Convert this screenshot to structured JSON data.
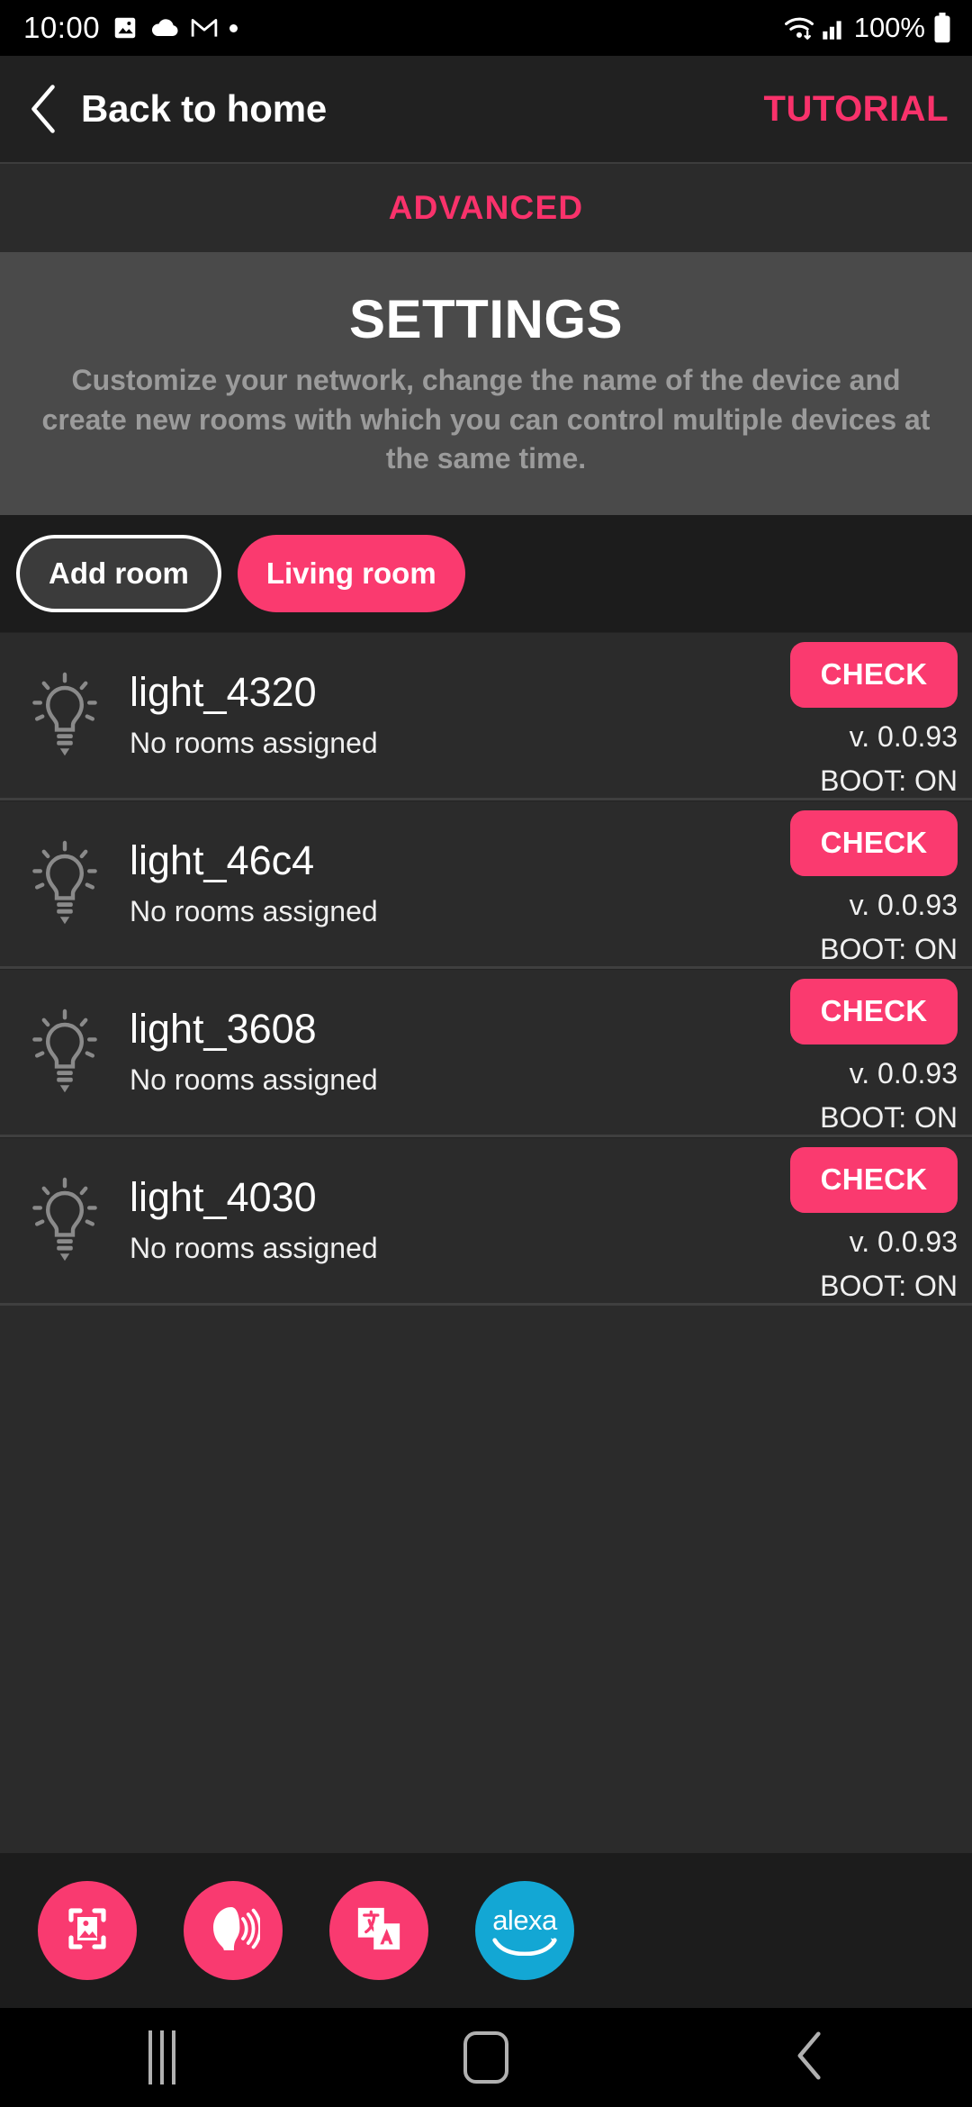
{
  "status_bar": {
    "time": "10:00",
    "icons": [
      "image-icon",
      "cloud-icon",
      "gmail-icon",
      "dot-indicator"
    ],
    "wifi": "wifi-icon",
    "signal": "cellular-signal-icon",
    "battery_percent": "100%",
    "battery": "battery-full-icon"
  },
  "header": {
    "back_label": "Back to home",
    "back_icon": "chevron-left-icon",
    "tutorial_label": "TUTORIAL"
  },
  "advanced": {
    "label": "ADVANCED"
  },
  "settings": {
    "title": "SETTINGS",
    "description": "Customize your network, change the name of the device and create new rooms with which you can control multiple devices at the same time."
  },
  "rooms": {
    "add_label": "Add room",
    "chips": [
      {
        "label": "Living room",
        "selected": true
      }
    ]
  },
  "devices": [
    {
      "name": "light_4320",
      "room": "No rooms assigned",
      "check_label": "CHECK",
      "version": "v. 0.0.93",
      "boot": "BOOT: ON",
      "icon": "lightbulb-icon"
    },
    {
      "name": "light_46c4",
      "room": "No rooms assigned",
      "check_label": "CHECK",
      "version": "v. 0.0.93",
      "boot": "BOOT: ON",
      "icon": "lightbulb-icon"
    },
    {
      "name": "light_3608",
      "room": "No rooms assigned",
      "check_label": "CHECK",
      "version": "v. 0.0.93",
      "boot": "BOOT: ON",
      "icon": "lightbulb-icon"
    },
    {
      "name": "light_4030",
      "room": "No rooms assigned",
      "check_label": "CHECK",
      "version": "v. 0.0.93",
      "boot": "BOOT: ON",
      "icon": "lightbulb-icon"
    }
  ],
  "actions": [
    {
      "icon": "gallery-image-icon",
      "color": "#f93a70"
    },
    {
      "icon": "voice-speak-icon",
      "color": "#f93a70"
    },
    {
      "icon": "translate-icon",
      "color": "#f93a70"
    },
    {
      "icon": "alexa-icon",
      "label": "alexa",
      "color": "#13a7d4"
    }
  ],
  "navbar": {
    "recents": "recents-icon",
    "home": "home-icon",
    "back": "back-icon"
  },
  "colors": {
    "accent_pink": "#fa3a6f",
    "alexa_blue": "#13a7d4",
    "card_bg": "#4a4a4a",
    "row_bg": "#2b2b2b",
    "page_bg": "#1c1c1c"
  }
}
